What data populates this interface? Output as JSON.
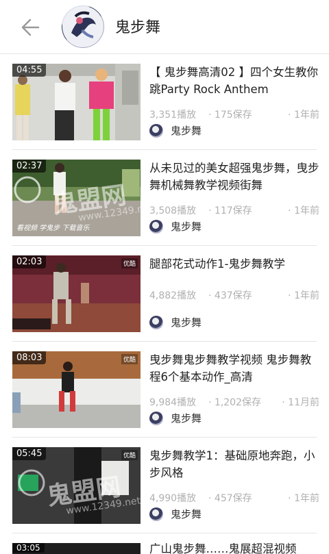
{
  "header": {
    "title": "鬼步舞",
    "back_icon": "back-arrow-icon"
  },
  "videos": [
    {
      "duration": "04:55",
      "title": "【 鬼步舞高清02 】四个女生教你跳Party Rock Anthem",
      "plays": "3,351播放",
      "saves": "175保存",
      "time": "1年前",
      "author": "鬼步舞"
    },
    {
      "duration": "02:37",
      "title": "从未见过的美女超强鬼步舞，曳步舞机械舞教学视频街舞",
      "plays": "3,508播放",
      "saves": "117保存",
      "time": "1年前",
      "author": "鬼步舞"
    },
    {
      "duration": "02:03",
      "title": "腿部花式动作1-鬼步舞教学",
      "plays": "4,882播放",
      "saves": "437保存",
      "time": "1年前",
      "author": "鬼步舞"
    },
    {
      "duration": "08:03",
      "title": "曳步舞鬼步舞教学视频 鬼步舞教程6个基本动作_高清",
      "plays": "9,984播放",
      "saves": "1,202保存",
      "time": "11月前",
      "author": "鬼步舞"
    },
    {
      "duration": "05:45",
      "title": "鬼步舞教学1：基础原地奔跑，小步风格",
      "plays": "4,990播放",
      "saves": "457保存",
      "time": "1年前",
      "author": "鬼步舞"
    },
    {
      "duration": "03:05",
      "title": "广山鬼步舞……鬼展超混视频",
      "plays": "",
      "saves": "",
      "time": "",
      "author": ""
    }
  ],
  "watermark": {
    "text": "鬼盟网",
    "url": "www.12349.net"
  },
  "thumb_overlays": {
    "logo": "优酷",
    "subtitle": "看视频 学鬼步 下载音乐"
  }
}
